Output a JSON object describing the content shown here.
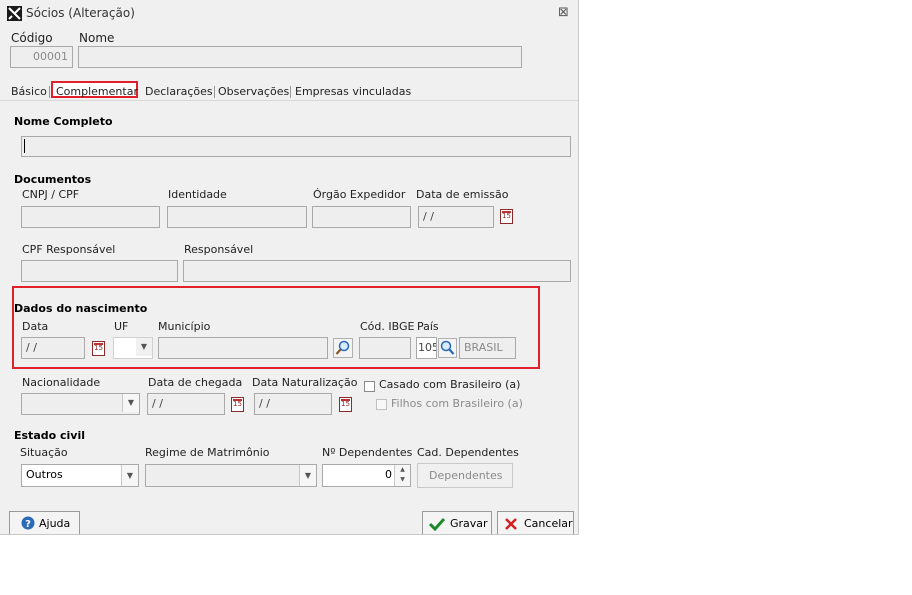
{
  "window": {
    "title": "Sócios (Alteração)",
    "close_glyph": "⊠"
  },
  "header": {
    "codigo_label": "Código",
    "codigo_value": "00001",
    "nome_label": "Nome",
    "nome_value": ""
  },
  "tabs": [
    {
      "label": "Básico"
    },
    {
      "label": "Complementar"
    },
    {
      "label": "Declarações"
    },
    {
      "label": "Observações"
    },
    {
      "label": "Empresas vinculadas"
    }
  ],
  "active_tab": "Complementar",
  "nome_completo": {
    "section_label": "Nome Completo",
    "value": ""
  },
  "documentos": {
    "section_label": "Documentos",
    "cnpj_cpf_label": "CNPJ / CPF",
    "identidade_label": "Identidade",
    "orgao_label": "Órgão Expedidor",
    "data_emissao_label": "Data de emissão",
    "data_emissao_value": " /  /",
    "cpf_responsavel_label": "CPF Responsável",
    "responsavel_label": "Responsável"
  },
  "nascimento": {
    "section_label": "Dados do nascimento",
    "data_label": "Data",
    "data_value": "  /  /",
    "uf_label": "UF",
    "municipio_label": "Município",
    "cod_ibge_label": "Cód. IBGE",
    "pais_label": "País",
    "pais_code": "105",
    "pais_name": "BRASIL"
  },
  "outros": {
    "nacionalidade_label": "Nacionalidade",
    "data_chegada_label": "Data de chegada",
    "data_chegada_value": " /  /",
    "data_naturalizacao_label": "Data Naturalização",
    "data_naturalizacao_value": " /  /",
    "casado_label": "Casado com Brasileiro (a)",
    "filhos_label": "Filhos com Brasileiro (a)"
  },
  "estado_civil": {
    "section_label": "Estado civil",
    "situacao_label": "Situação",
    "situacao_value": "Outros",
    "regime_label": "Regime de Matrimônio",
    "dependentes_label": "Nº Dependentes",
    "dependentes_value": "0",
    "cad_dependentes_label": "Cad. Dependentes",
    "dependentes_button": "Dependentes"
  },
  "buttons": {
    "ajuda": "Ajuda",
    "gravar": "Gravar",
    "cancelar": "Cancelar"
  },
  "calendar_icon_text": "15",
  "colors": {
    "highlight": "#e0202a",
    "accent_blue": "#2a6ab8",
    "confirm_green": "#1e8a2a",
    "cancel_red": "#d02020"
  }
}
